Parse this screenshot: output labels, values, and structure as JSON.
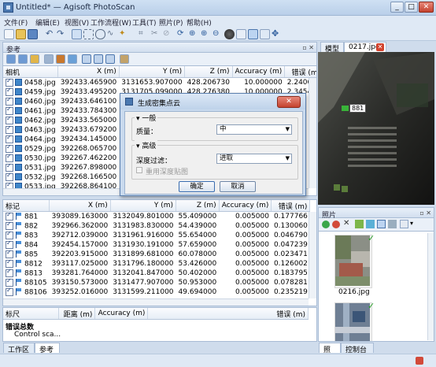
{
  "window": {
    "title": "Untitled* — Agisoft PhotoScan",
    "buttons": [
      "_",
      "□",
      "✕"
    ]
  },
  "menubar": [
    "文件(F)",
    "编辑(E)",
    "视图(V)",
    "工作流程(W)",
    "工具(T)",
    "照片(P)",
    "帮助(H)"
  ],
  "left_panel": {
    "title": "参考",
    "cameras_table": {
      "headers": [
        "相机",
        "X (m)",
        "Y (m)",
        "Z (m)",
        "Accuracy (m)",
        "错误 (m)"
      ],
      "rows": [
        [
          "0458.jpg",
          "392433.465900",
          "3131653.907000",
          "428.206730",
          "10.000000",
          "2.240600"
        ],
        [
          "0459.jpg",
          "392433.495200",
          "3131705.099000",
          "428.276380",
          "10.000000",
          "2.345490"
        ],
        [
          "0460.jpg",
          "392433.646100",
          "313175",
          "",
          "",
          ""
        ],
        [
          "0461.jpg",
          "392433.784300",
          "313180",
          "",
          "",
          ""
        ],
        [
          "0462.jpg",
          "392433.565000",
          "313185",
          "",
          "",
          ""
        ],
        [
          "0463.jpg",
          "392433.679200",
          "313190",
          "",
          "",
          ""
        ],
        [
          "0464.jpg",
          "392434.145000",
          "313195",
          "",
          "",
          ""
        ],
        [
          "0529.jpg",
          "392268.065700",
          "313195",
          "",
          "",
          ""
        ],
        [
          "0530.jpg",
          "392267.462200",
          "313190",
          "",
          "",
          ""
        ],
        [
          "0531.jpg",
          "392267.898000",
          "313185",
          "",
          "",
          ""
        ],
        [
          "0532.jpg",
          "392268.166500",
          "313180",
          "",
          "",
          ""
        ],
        [
          "0533.jpg",
          "392268.864100",
          "313175",
          "",
          "",
          ""
        ]
      ]
    },
    "markers_table": {
      "headers": [
        "标记",
        "X (m)",
        "Y (m)",
        "Z (m)",
        "Accuracy (m)",
        "错误 (m)"
      ],
      "rows": [
        [
          "881",
          "393089.163000",
          "3132049.801000",
          "55.409000",
          "0.005000",
          "0.177766"
        ],
        [
          "882",
          "392966.362000",
          "3131983.830000",
          "54.439000",
          "0.005000",
          "0.130060"
        ],
        [
          "883",
          "392712.039000",
          "3131961.916000",
          "55.654000",
          "0.005000",
          "0.046790"
        ],
        [
          "884",
          "392454.157000",
          "3131930.191000",
          "57.659000",
          "0.005000",
          "0.047239"
        ],
        [
          "885",
          "392203.915000",
          "3131899.681000",
          "60.078000",
          "0.005000",
          "0.023471"
        ],
        [
          "8812",
          "393117.025000",
          "3131796.180000",
          "53.426000",
          "0.005000",
          "0.126002"
        ],
        [
          "8813",
          "393281.764000",
          "3132041.847000",
          "50.402000",
          "0.005000",
          "0.183795"
        ],
        [
          "88105",
          "393150.573000",
          "3131477.907000",
          "50.953000",
          "0.005000",
          "0.078281"
        ],
        [
          "88106",
          "393252.016000",
          "3131599.211000",
          "49.694000",
          "0.005000",
          "0.235219"
        ]
      ]
    },
    "scale_table": {
      "headers": [
        "标尺",
        "距离 (m)",
        "Accuracy (m)",
        "错误 (m)"
      ]
    },
    "error_summary": {
      "title": "错误总数",
      "item": "Control sca..."
    },
    "bottom_tabs": [
      "工作区",
      "参考"
    ]
  },
  "right_panel": {
    "tabs": [
      "模型",
      "0217.jpg"
    ],
    "marker_label": "881",
    "photos_title": "照片",
    "photos": [
      {
        "name": "0216.jpg"
      },
      {
        "name": ""
      }
    ],
    "bottom_tabs": [
      "照片",
      "控制台"
    ]
  },
  "dialog": {
    "title": "生成密集点云",
    "general_label": "一般",
    "quality_label": "质量：",
    "quality_value": "中",
    "advanced_label": "高级",
    "depth_filter_label": "深度过滤：",
    "depth_filter_value": "进取",
    "reuse_depth_label": "重用深度贴图",
    "ok_label": "确定",
    "cancel_label": "取消"
  }
}
